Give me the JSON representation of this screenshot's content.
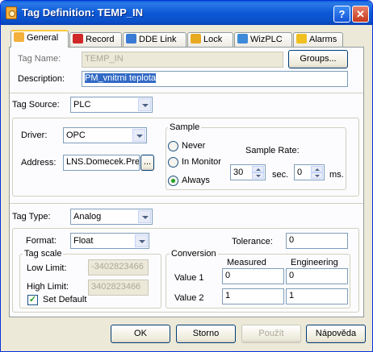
{
  "window": {
    "title": "Tag Definition: TEMP_IN",
    "help_glyph": "?",
    "close_glyph": "✕"
  },
  "tabs": [
    {
      "label": "General",
      "icon": "tag-icon",
      "color": "#f3b03c"
    },
    {
      "label": "Record",
      "icon": "record-icon",
      "color": "#d02828"
    },
    {
      "label": "DDE Link",
      "icon": "link-icon",
      "color": "#3a7bd5"
    },
    {
      "label": "Lock",
      "icon": "lock-icon",
      "color": "#e8a820"
    },
    {
      "label": "WizPLC",
      "icon": "plc-icon",
      "color": "#3c8ad8"
    },
    {
      "label": "Alarms",
      "icon": "warning-icon",
      "color": "#f0c020"
    }
  ],
  "general": {
    "tag_name_label": "Tag Name:",
    "tag_name_value": "TEMP_IN",
    "groups_button": "Groups...",
    "description_label": "Description:",
    "description_value": "PM_vnitrni teplota",
    "tag_source_label": "Tag Source:",
    "tag_source_value": "PLC",
    "driver_label": "Driver:",
    "driver_value": "OPC",
    "address_label": "Address:",
    "address_value": "LNS.Domecek.Pre",
    "address_browse": "...",
    "sample": {
      "group_label": "Sample",
      "never": "Never",
      "in_monitor": "In Monitor",
      "always": "Always",
      "selected": "always",
      "rate_label": "Sample Rate:",
      "sec_value": "30",
      "sec_unit": "sec.",
      "ms_value": "0",
      "ms_unit": "ms."
    },
    "tag_type_label": "Tag Type:",
    "tag_type_value": "Analog",
    "format_label": "Format:",
    "format_value": "Float",
    "tolerance_label": "Tolerance:",
    "tolerance_value": "0",
    "tag_scale": {
      "group_label": "Tag scale",
      "low_label": "Low Limit:",
      "low_value": "-3402823466",
      "high_label": "High Limit:",
      "high_value": "3402823466",
      "set_default": "Set Default",
      "set_default_checked": true
    },
    "conversion": {
      "group_label": "Conversion",
      "measured_header": "Measured",
      "engineering_header": "Engineering",
      "value1_label": "Value 1",
      "value1_measured": "0",
      "value1_engineering": "0",
      "value2_label": "Value 2",
      "value2_measured": "1",
      "value2_engineering": "1"
    }
  },
  "buttons": {
    "ok": "OK",
    "cancel": "Storno",
    "apply": "Použít",
    "help": "Nápověda"
  }
}
